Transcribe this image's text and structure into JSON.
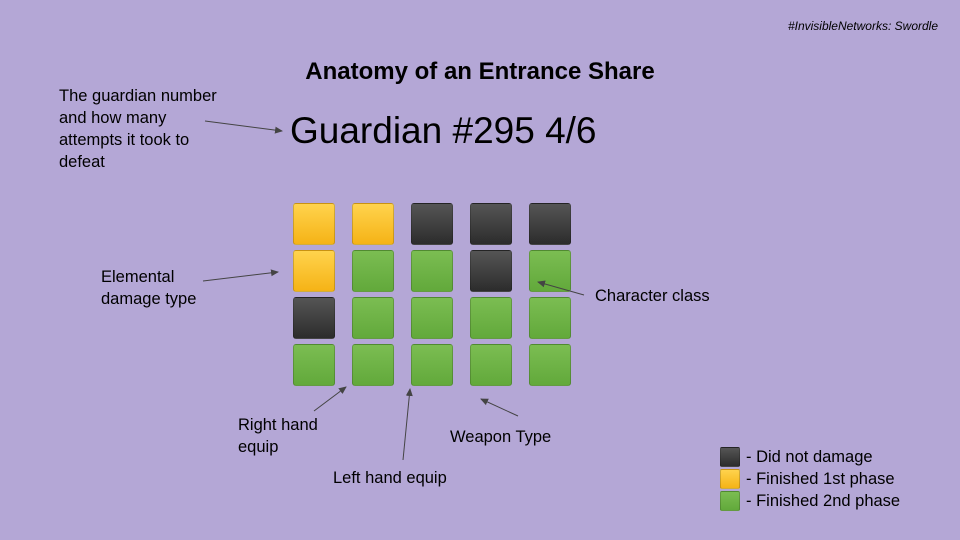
{
  "hashtag": "#InvisibleNetworks: Swordle",
  "title": "Anatomy of an Entrance Share",
  "guardian_text": "Guardian #295 4/6",
  "annotations": {
    "guardian_number": [
      "The guardian number",
      "and how many",
      "attempts it took to",
      "defeat"
    ],
    "elemental": [
      "Elemental",
      "damage type"
    ],
    "character_class": "Character class",
    "right_hand": [
      "Right hand",
      "equip"
    ],
    "left_hand": "Left hand equip",
    "weapon_type": "Weapon Type"
  },
  "grid": [
    [
      "yellow",
      "yellow",
      "black",
      "black",
      "black"
    ],
    [
      "yellow",
      "green",
      "green",
      "black",
      "green"
    ],
    [
      "black",
      "green",
      "green",
      "green",
      "green"
    ],
    [
      "green",
      "green",
      "green",
      "green",
      "green"
    ]
  ],
  "legend": [
    {
      "color": "black",
      "label": "- Did not damage"
    },
    {
      "color": "yellow",
      "label": "- Finished 1st phase"
    },
    {
      "color": "green",
      "label": "- Finished 2nd phase"
    }
  ],
  "colors": {
    "background": "#b4a7d6",
    "black": "#3a3a3a",
    "yellow": "#fbbc1c",
    "green": "#6aaf42"
  }
}
